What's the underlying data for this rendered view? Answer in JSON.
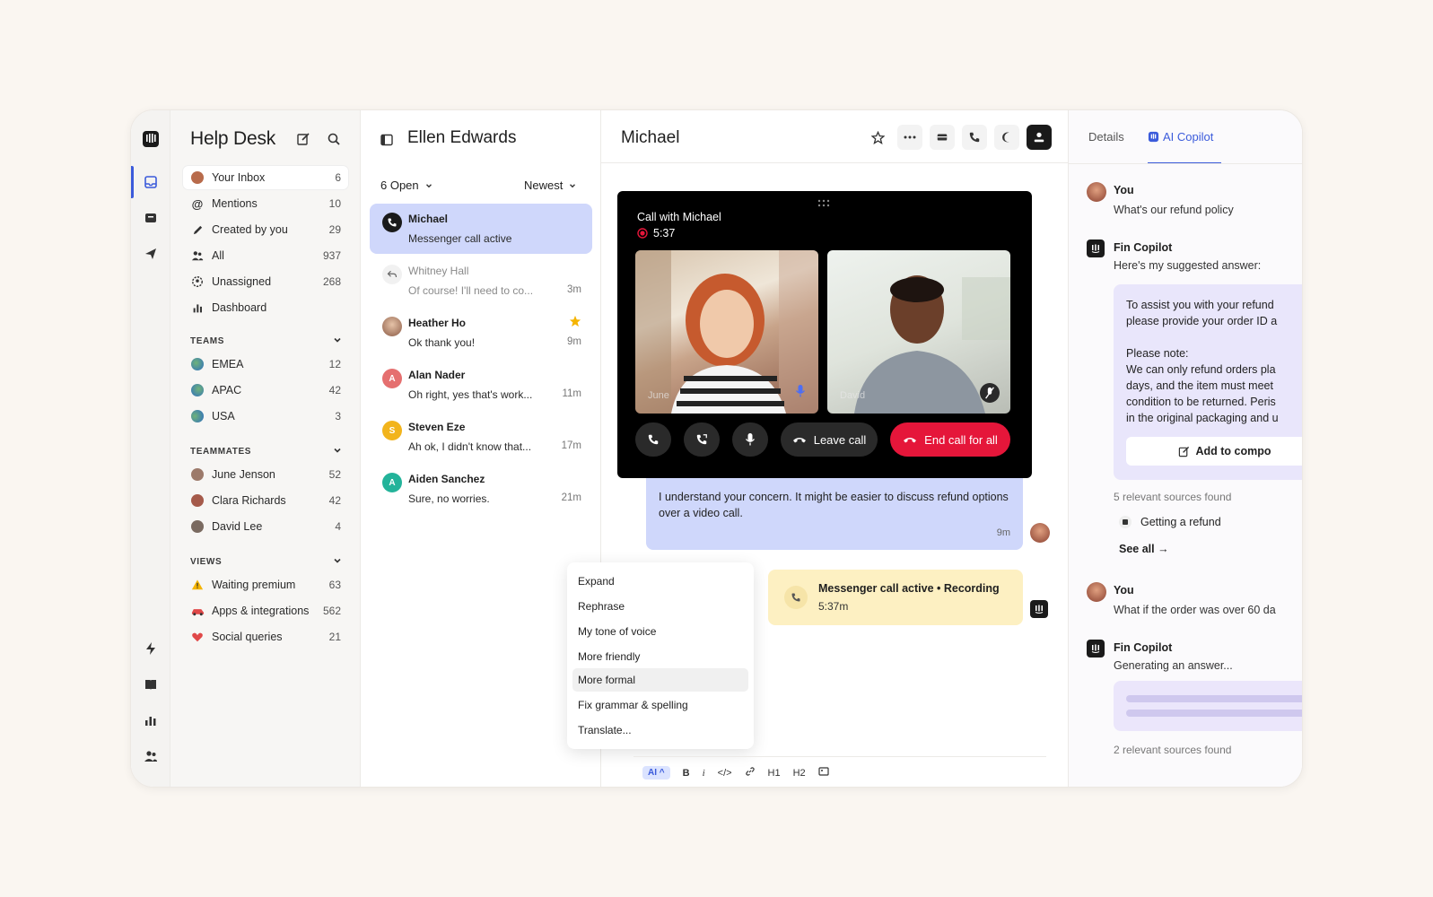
{
  "sidebar": {
    "title": "Help Desk",
    "inbox": [
      {
        "label": "Your Inbox",
        "count": "6"
      },
      {
        "label": "Mentions",
        "count": "10"
      },
      {
        "label": "Created by you",
        "count": "29"
      },
      {
        "label": "All",
        "count": "937"
      },
      {
        "label": "Unassigned",
        "count": "268"
      },
      {
        "label": "Dashboard",
        "count": ""
      }
    ],
    "teams_title": "TEAMS",
    "teams": [
      {
        "label": "EMEA",
        "count": "12"
      },
      {
        "label": "APAC",
        "count": "42"
      },
      {
        "label": "USA",
        "count": "3"
      }
    ],
    "teammates_title": "TEAMMATES",
    "teammates": [
      {
        "label": "June Jenson",
        "count": "52"
      },
      {
        "label": "Clara Richards",
        "count": "42"
      },
      {
        "label": "David Lee",
        "count": "4"
      }
    ],
    "views_title": "VIEWS",
    "views": [
      {
        "label": "Waiting premium",
        "count": "63"
      },
      {
        "label": "Apps & integrations",
        "count": "562"
      },
      {
        "label": "Social queries",
        "count": "21"
      }
    ]
  },
  "convlist": {
    "title": "Ellen Edwards",
    "filter": "6 Open",
    "sort": "Newest",
    "items": [
      {
        "name": "Michael",
        "preview": "Messenger call active",
        "time": ""
      },
      {
        "name": "Whitney Hall",
        "preview": "Of course! I'll need to co...",
        "time": "3m"
      },
      {
        "name": "Heather Ho",
        "preview": "Ok thank you!",
        "time": "9m"
      },
      {
        "name": "Alan Nader",
        "preview": "Oh right, yes that's work...",
        "time": "11m",
        "initial": "A"
      },
      {
        "name": "Steven Eze",
        "preview": "Ah ok, I didn't know that...",
        "time": "17m",
        "initial": "S"
      },
      {
        "name": "Aiden Sanchez",
        "preview": "Sure, no worries.",
        "time": "21m",
        "initial": "A"
      }
    ]
  },
  "main": {
    "title": "Michael",
    "call": {
      "title": "Call with Michael",
      "duration": "5:37",
      "participant_left": "June",
      "participant_right": "David",
      "leave": "Leave call",
      "end": "End call for all"
    },
    "message": {
      "text": "I understand your concern. It might be easier to discuss refund options over a video call.",
      "time": "9m"
    },
    "note": {
      "title": "Messenger call active • Recording",
      "subtitle": "5:37m"
    },
    "menu": [
      "Expand",
      "Rephrase",
      "My tone of voice",
      "More friendly",
      "More formal",
      "Fix grammar & spelling",
      "Translate..."
    ],
    "format": {
      "ai": "AI",
      "bold": "B",
      "italic": "i",
      "code": "</>",
      "h1": "H1",
      "h2": "H2"
    }
  },
  "right": {
    "tab_details": "Details",
    "tab_copilot": "AI Copilot",
    "you1_name": "You",
    "you1_text": "What's our refund policy",
    "fin1_name": "Fin Copilot",
    "fin1_text": "Here's my suggested answer:",
    "answer_l1": "To assist you with your refund",
    "answer_l2": "please provide your order ID a",
    "answer_l3": "Please note:",
    "answer_l4": "We can only refund orders pla",
    "answer_l5": "days, and the item must meet",
    "answer_l6": "condition to be returned. Peris",
    "answer_l7": "in the original packaging and u",
    "add_btn": "Add to compo",
    "sources1": "5 relevant sources found",
    "source_item": "Getting a refund",
    "see_all": "See all →",
    "you2_name": "You",
    "you2_text": "What if the order was over 60 da",
    "fin2_name": "Fin Copilot",
    "fin2_text": "Generating an answer...",
    "sources2": "2 relevant sources found"
  },
  "colors": {
    "accent": "#3b5bdb",
    "selected": "#cfd7fb",
    "end_call": "#e5163a",
    "note": "#fdf0c2"
  }
}
